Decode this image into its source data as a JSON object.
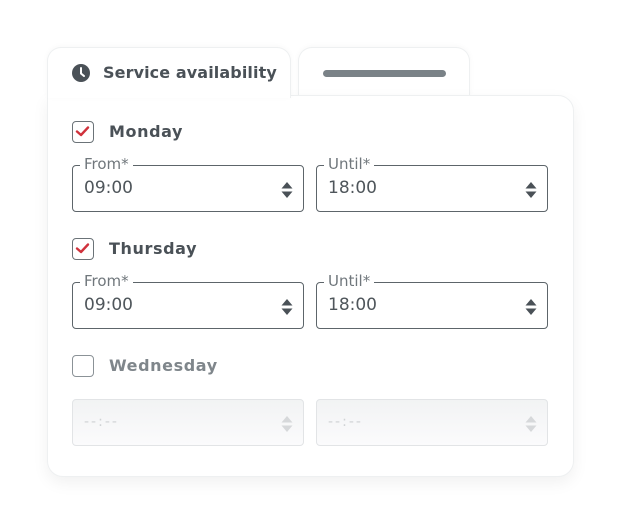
{
  "tabs": [
    {
      "label": "Service availability",
      "icon": "clock-icon",
      "active": true
    },
    {
      "label": "",
      "placeholder": true,
      "active": false
    }
  ],
  "colors": {
    "check_accent": "#d0323c",
    "text": "#4a5157",
    "border": "#5d656a"
  },
  "days": [
    {
      "name": "Monday",
      "checked": true,
      "from_label": "From*",
      "from": "09:00",
      "until_label": "Until*",
      "until": "18:00"
    },
    {
      "name": "Thursday",
      "checked": true,
      "from_label": "From*",
      "from": "09:00",
      "until_label": "Until*",
      "until": "18:00"
    },
    {
      "name": "Wednesday",
      "checked": false,
      "from": "--:--",
      "until": "--:--"
    }
  ]
}
